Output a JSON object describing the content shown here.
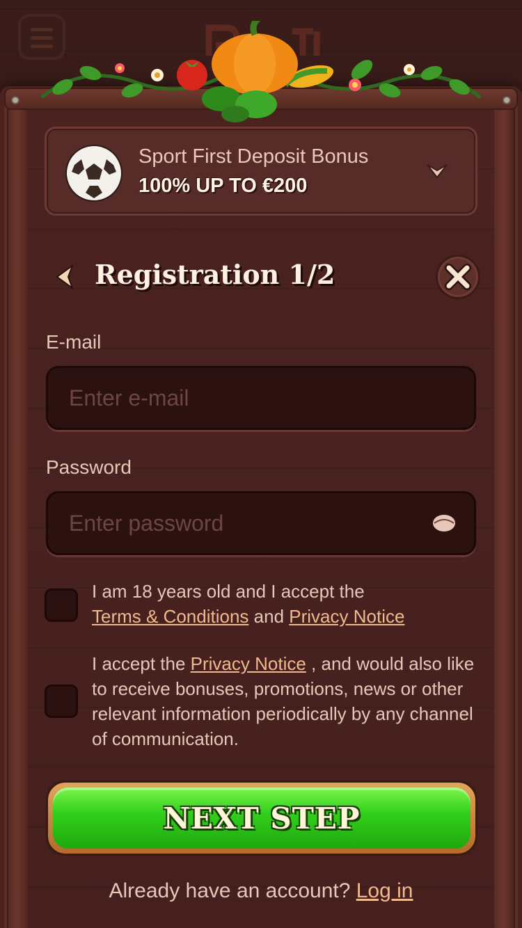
{
  "bonus": {
    "title": "Sport First Deposit Bonus",
    "subtitle": "100% UP TO €200"
  },
  "header": {
    "title": "Registration 1/2"
  },
  "form": {
    "email_label": "E-mail",
    "email_placeholder": "Enter e-mail",
    "email_value": "",
    "password_label": "Password",
    "password_placeholder": "Enter password",
    "password_value": ""
  },
  "consent1": {
    "text_before": "I am 18 years old and I accept the",
    "terms_link": "Terms & Conditions",
    "and": "and",
    "privacy_link": "Privacy Notice",
    "checked": false
  },
  "consent2": {
    "text_before": "I accept the",
    "privacy_link": "Privacy Notice",
    "text_after": ", and would also like to receive bonuses, promotions, news or other relevant information periodically by any channel of communication.",
    "checked": false
  },
  "next_button": {
    "label": "NEXT STEP"
  },
  "footer": {
    "question": "Already have an account?",
    "login_link": "Log in"
  },
  "colors": {
    "panel": "#45201e",
    "accent_link": "#f0b98e",
    "button_green": "#33d11d"
  }
}
